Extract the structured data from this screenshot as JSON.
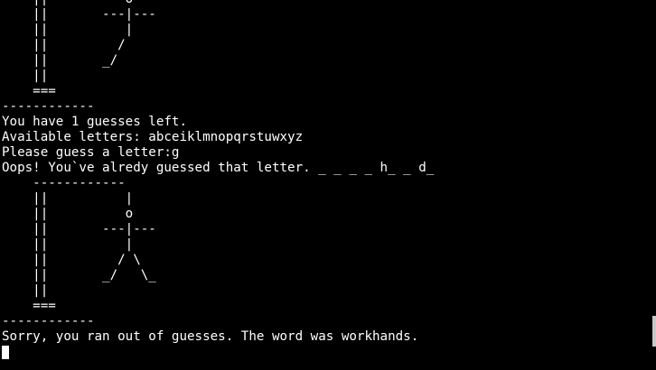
{
  "terminal": {
    "lines": [
      "    ||          o",
      "    ||       ---|---",
      "    ||          |",
      "    ||         /",
      "    ||       _/",
      "    ||",
      "    ===",
      "------------",
      "You have 1 guesses left.",
      "Available letters: abceiklmnopqrstuwxyz",
      "Please guess a letter:g",
      "Oops! You`ve alredy guessed that letter. _ _ _ _ h_ _ d_",
      "    ------------",
      "    ||          |",
      "    ||          o",
      "    ||       ---|---",
      "    ||          |",
      "    ||         / \\",
      "    ||       _/   \\_",
      "    ||",
      "    ===",
      "------------",
      "Sorry, you ran out of guesses. The word was workhands.",
      ""
    ]
  }
}
